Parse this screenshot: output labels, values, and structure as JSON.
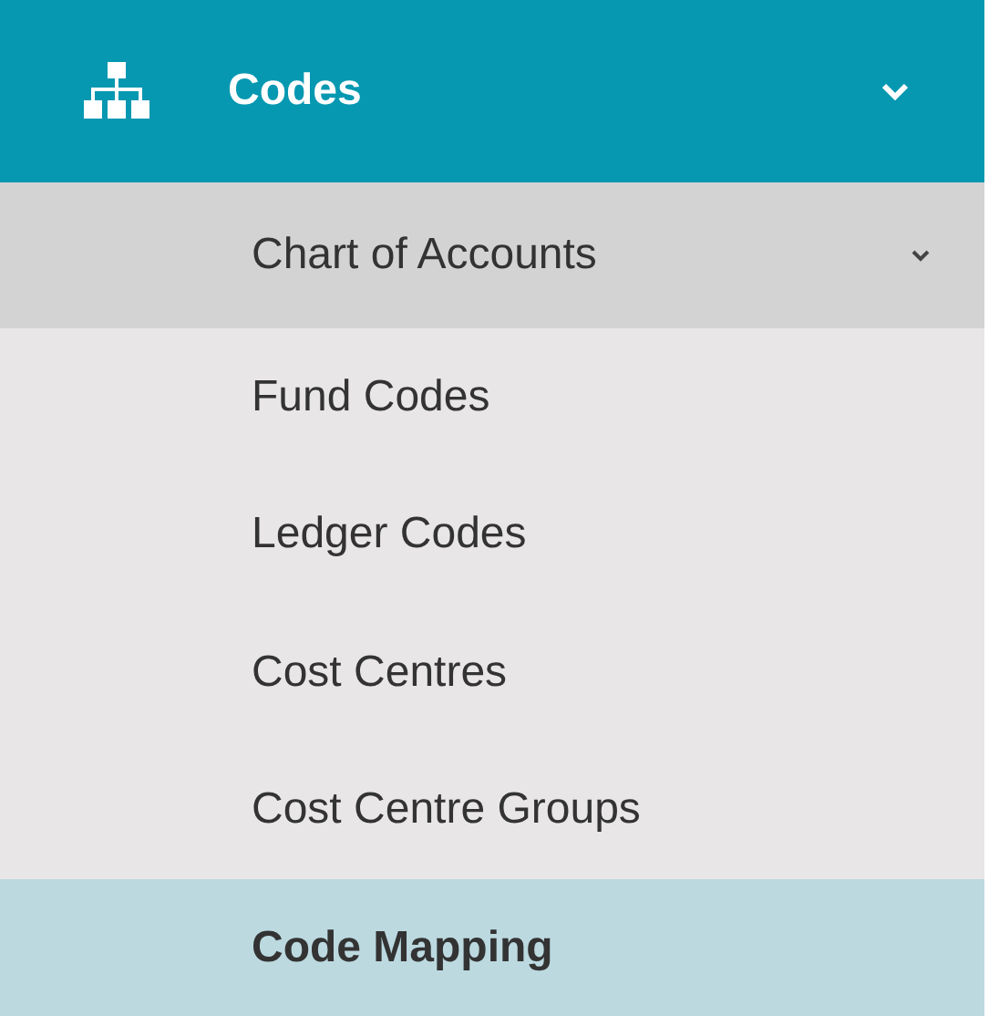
{
  "menu": {
    "title": "Codes",
    "expanded": true,
    "items": [
      {
        "label": "Chart of Accounts",
        "kind": "group",
        "selected": false
      },
      {
        "label": "Fund Codes",
        "kind": "link",
        "selected": false
      },
      {
        "label": "Ledger Codes",
        "kind": "link",
        "selected": false
      },
      {
        "label": "Cost Centres",
        "kind": "link",
        "selected": false
      },
      {
        "label": "Cost Centre Groups",
        "kind": "link",
        "selected": false
      },
      {
        "label": "Code Mapping",
        "kind": "link",
        "selected": true
      }
    ]
  }
}
